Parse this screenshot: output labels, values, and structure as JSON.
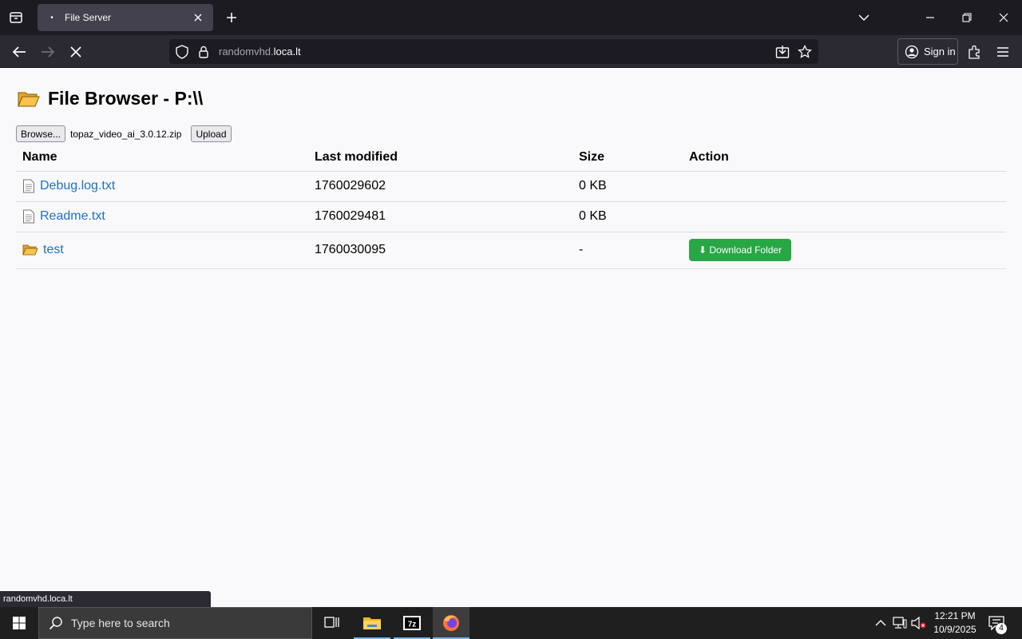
{
  "browser": {
    "tab_title": "File Server",
    "url_host_dim": "randomvhd.",
    "url_host_main": "loca.lt",
    "signin_label": "Sign in",
    "status_link": "randomvhd.loca.lt"
  },
  "page": {
    "title": "File Browser - P:\\\\",
    "browse_label": "Browse...",
    "selected_file": "topaz_video_ai_3.0.12.zip",
    "upload_label": "Upload",
    "columns": [
      "Name",
      "Last modified",
      "Size",
      "Action"
    ],
    "rows": [
      {
        "name": "Debug.log.txt",
        "modified": "1760029602",
        "size": "0 KB",
        "action": ""
      },
      {
        "name": "Readme.txt",
        "modified": "1760029481",
        "size": "0 KB",
        "action": ""
      },
      {
        "name": "test",
        "modified": "1760030095",
        "size": "-",
        "action": "⬇ Download Folder"
      }
    ],
    "accent_color": "#28a745",
    "link_color": "#1a73c8"
  },
  "taskbar": {
    "search_placeholder": "Type here to search",
    "time": "12:21 PM",
    "date": "10/9/2025",
    "notification_count": "4"
  }
}
